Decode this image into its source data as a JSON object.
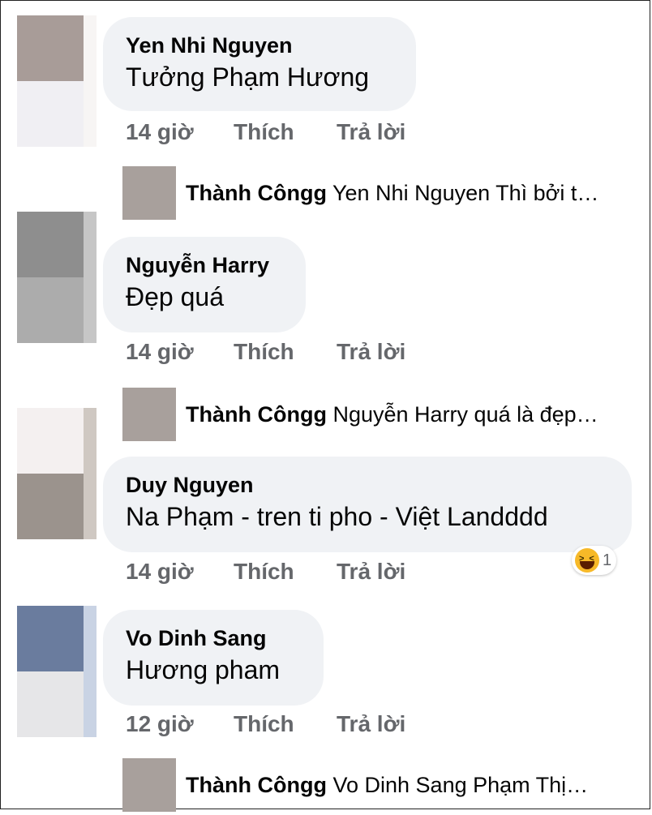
{
  "comments": [
    {
      "name": "Yen Nhi Nguyen",
      "text": "Tưởng Phạm Hương",
      "time": "14 giờ",
      "like": "Thích",
      "reply": "Trả lời",
      "avatar_colors": [
        "#a89c98",
        "#f0eff3",
        "#f7f5f4"
      ],
      "reply_preview": {
        "name": "Thành Côngg",
        "text": "Yen Nhi Nguyen Thì bởi t…"
      }
    },
    {
      "name": "Nguyễn Harry",
      "text": "Đẹp quá",
      "time": "14 giờ",
      "like": "Thích",
      "reply": "Trả lời",
      "avatar_colors": [
        "#8e8e8e",
        "#acacac",
        "#c6c6c6"
      ],
      "reply_preview": {
        "name": "Thành Côngg",
        "text": "Nguyễn Harry quá là đẹp…"
      }
    },
    {
      "name": "Duy Nguyen",
      "text": "Na Phạm - tren ti pho - Việt Landddd",
      "time": "14 giờ",
      "like": "Thích",
      "reply": "Trả lời",
      "avatar_colors": [
        "#f4f0f0",
        "#9b938d",
        "#cfc8c2"
      ],
      "reaction": {
        "icon": "haha-emoji-icon",
        "count": "1"
      }
    },
    {
      "name": "Vo Dinh Sang",
      "text": "Hương pham",
      "time": "12 giờ",
      "like": "Thích",
      "reply": "Trả lời",
      "avatar_colors": [
        "#6a7c9e",
        "#e6e6e8",
        "#c9d3e4"
      ],
      "reply_preview": {
        "name": "Thành Côngg",
        "text": "Vo Dinh Sang Phạm Thị…"
      }
    }
  ],
  "colors": {
    "bubble": "#f0f2f5",
    "text": "#050505",
    "secondary": "#65676b",
    "reply_avatar": "#a8a09c"
  }
}
